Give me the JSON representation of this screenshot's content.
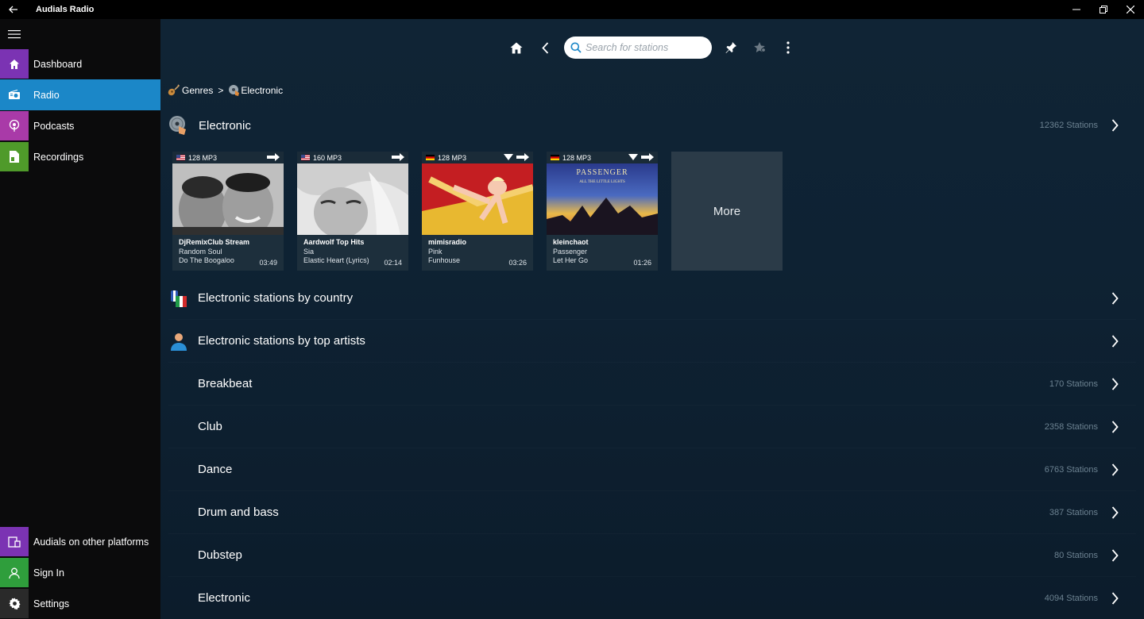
{
  "app": {
    "title": "Audials Radio"
  },
  "sidebar": {
    "items": [
      {
        "label": "Dashboard",
        "color": "#7b33b3"
      },
      {
        "label": "Radio",
        "color": "#1b87c8"
      },
      {
        "label": "Podcasts",
        "color": "#a93aa8"
      },
      {
        "label": "Recordings",
        "color": "#4f9a2a"
      }
    ],
    "bottom": [
      {
        "label": "Audials on other platforms",
        "color": "#7b33b3"
      },
      {
        "label": "Sign In",
        "color": "#2f9e3c"
      },
      {
        "label": "Settings",
        "color": "#2a2a2a"
      }
    ]
  },
  "search": {
    "placeholder": "Search for stations"
  },
  "breadcrumb": {
    "root": "Genres",
    "separator": ">",
    "current": "Electronic"
  },
  "section": {
    "title": "Electronic",
    "count": "12362 Stations"
  },
  "cards": [
    {
      "quality": "128 MP3",
      "country": "us",
      "station": "DjRemixClub Stream",
      "artist": "Random Soul",
      "track": "Do The Boogaloo",
      "time": "03:49"
    },
    {
      "quality": "160 MP3",
      "country": "us",
      "station": "Aardwolf Top Hits",
      "artist": "Sia",
      "track": "Elastic Heart (Lyrics)",
      "time": "02:14"
    },
    {
      "quality": "128 MP3",
      "country": "de",
      "station": "mimisradio",
      "artist": "Pink",
      "track": "Funhouse",
      "time": "03:26"
    },
    {
      "quality": "128 MP3",
      "country": "de",
      "station": "kleinchaot",
      "artist": "Passenger",
      "track": "Let Her Go",
      "time": "01:26"
    }
  ],
  "more_label": "More",
  "album_art_text": {
    "passenger_title": "PASSENGER",
    "passenger_sub": "ALL THE LITTLE LIGHTS"
  },
  "list": [
    {
      "label": "Electronic stations by country",
      "count": ""
    },
    {
      "label": "Electronic stations by top artists",
      "count": ""
    },
    {
      "label": "Breakbeat",
      "count": "170 Stations"
    },
    {
      "label": "Club",
      "count": "2358 Stations"
    },
    {
      "label": "Dance",
      "count": "6763 Stations"
    },
    {
      "label": "Drum and bass",
      "count": "387 Stations"
    },
    {
      "label": "Dubstep",
      "count": "80 Stations"
    },
    {
      "label": "Electronic",
      "count": "4094 Stations"
    }
  ]
}
